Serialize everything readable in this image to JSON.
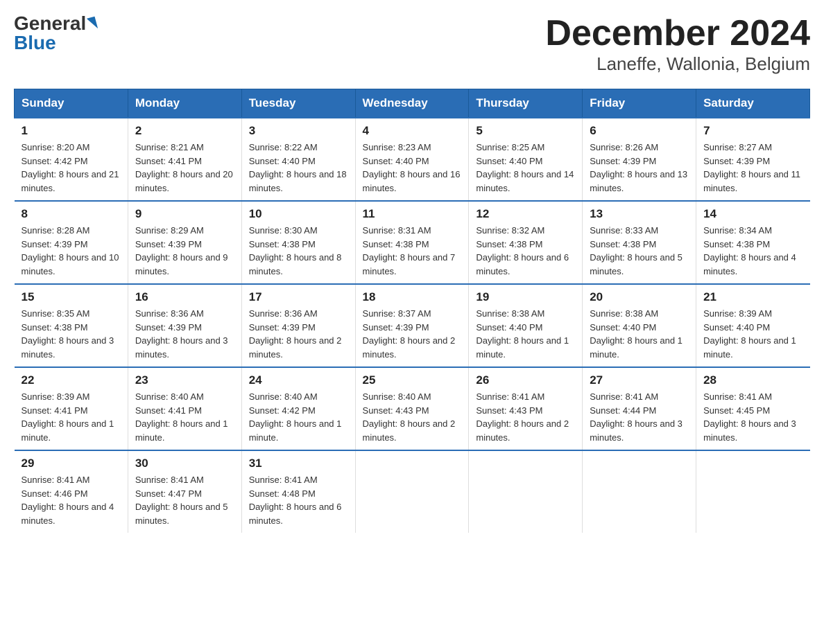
{
  "logo": {
    "general": "General",
    "blue": "Blue"
  },
  "title": "December 2024",
  "subtitle": "Laneffe, Wallonia, Belgium",
  "days_of_week": [
    "Sunday",
    "Monday",
    "Tuesday",
    "Wednesday",
    "Thursday",
    "Friday",
    "Saturday"
  ],
  "weeks": [
    [
      {
        "day": "1",
        "sunrise": "8:20 AM",
        "sunset": "4:42 PM",
        "daylight": "8 hours and 21 minutes."
      },
      {
        "day": "2",
        "sunrise": "8:21 AM",
        "sunset": "4:41 PM",
        "daylight": "8 hours and 20 minutes."
      },
      {
        "day": "3",
        "sunrise": "8:22 AM",
        "sunset": "4:40 PM",
        "daylight": "8 hours and 18 minutes."
      },
      {
        "day": "4",
        "sunrise": "8:23 AM",
        "sunset": "4:40 PM",
        "daylight": "8 hours and 16 minutes."
      },
      {
        "day": "5",
        "sunrise": "8:25 AM",
        "sunset": "4:40 PM",
        "daylight": "8 hours and 14 minutes."
      },
      {
        "day": "6",
        "sunrise": "8:26 AM",
        "sunset": "4:39 PM",
        "daylight": "8 hours and 13 minutes."
      },
      {
        "day": "7",
        "sunrise": "8:27 AM",
        "sunset": "4:39 PM",
        "daylight": "8 hours and 11 minutes."
      }
    ],
    [
      {
        "day": "8",
        "sunrise": "8:28 AM",
        "sunset": "4:39 PM",
        "daylight": "8 hours and 10 minutes."
      },
      {
        "day": "9",
        "sunrise": "8:29 AM",
        "sunset": "4:39 PM",
        "daylight": "8 hours and 9 minutes."
      },
      {
        "day": "10",
        "sunrise": "8:30 AM",
        "sunset": "4:38 PM",
        "daylight": "8 hours and 8 minutes."
      },
      {
        "day": "11",
        "sunrise": "8:31 AM",
        "sunset": "4:38 PM",
        "daylight": "8 hours and 7 minutes."
      },
      {
        "day": "12",
        "sunrise": "8:32 AM",
        "sunset": "4:38 PM",
        "daylight": "8 hours and 6 minutes."
      },
      {
        "day": "13",
        "sunrise": "8:33 AM",
        "sunset": "4:38 PM",
        "daylight": "8 hours and 5 minutes."
      },
      {
        "day": "14",
        "sunrise": "8:34 AM",
        "sunset": "4:38 PM",
        "daylight": "8 hours and 4 minutes."
      }
    ],
    [
      {
        "day": "15",
        "sunrise": "8:35 AM",
        "sunset": "4:38 PM",
        "daylight": "8 hours and 3 minutes."
      },
      {
        "day": "16",
        "sunrise": "8:36 AM",
        "sunset": "4:39 PM",
        "daylight": "8 hours and 3 minutes."
      },
      {
        "day": "17",
        "sunrise": "8:36 AM",
        "sunset": "4:39 PM",
        "daylight": "8 hours and 2 minutes."
      },
      {
        "day": "18",
        "sunrise": "8:37 AM",
        "sunset": "4:39 PM",
        "daylight": "8 hours and 2 minutes."
      },
      {
        "day": "19",
        "sunrise": "8:38 AM",
        "sunset": "4:40 PM",
        "daylight": "8 hours and 1 minute."
      },
      {
        "day": "20",
        "sunrise": "8:38 AM",
        "sunset": "4:40 PM",
        "daylight": "8 hours and 1 minute."
      },
      {
        "day": "21",
        "sunrise": "8:39 AM",
        "sunset": "4:40 PM",
        "daylight": "8 hours and 1 minute."
      }
    ],
    [
      {
        "day": "22",
        "sunrise": "8:39 AM",
        "sunset": "4:41 PM",
        "daylight": "8 hours and 1 minute."
      },
      {
        "day": "23",
        "sunrise": "8:40 AM",
        "sunset": "4:41 PM",
        "daylight": "8 hours and 1 minute."
      },
      {
        "day": "24",
        "sunrise": "8:40 AM",
        "sunset": "4:42 PM",
        "daylight": "8 hours and 1 minute."
      },
      {
        "day": "25",
        "sunrise": "8:40 AM",
        "sunset": "4:43 PM",
        "daylight": "8 hours and 2 minutes."
      },
      {
        "day": "26",
        "sunrise": "8:41 AM",
        "sunset": "4:43 PM",
        "daylight": "8 hours and 2 minutes."
      },
      {
        "day": "27",
        "sunrise": "8:41 AM",
        "sunset": "4:44 PM",
        "daylight": "8 hours and 3 minutes."
      },
      {
        "day": "28",
        "sunrise": "8:41 AM",
        "sunset": "4:45 PM",
        "daylight": "8 hours and 3 minutes."
      }
    ],
    [
      {
        "day": "29",
        "sunrise": "8:41 AM",
        "sunset": "4:46 PM",
        "daylight": "8 hours and 4 minutes."
      },
      {
        "day": "30",
        "sunrise": "8:41 AM",
        "sunset": "4:47 PM",
        "daylight": "8 hours and 5 minutes."
      },
      {
        "day": "31",
        "sunrise": "8:41 AM",
        "sunset": "4:48 PM",
        "daylight": "8 hours and 6 minutes."
      },
      null,
      null,
      null,
      null
    ]
  ],
  "labels": {
    "sunrise": "Sunrise:",
    "sunset": "Sunset:",
    "daylight": "Daylight:"
  }
}
